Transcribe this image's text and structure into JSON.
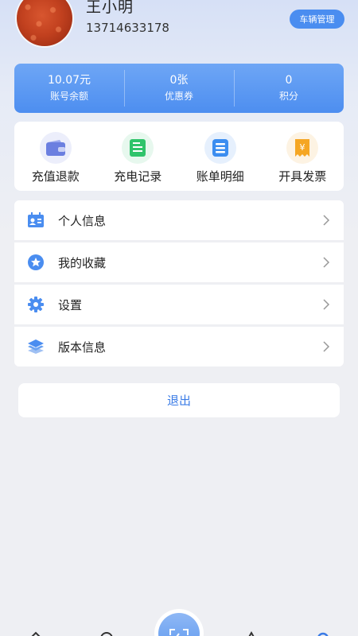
{
  "user": {
    "name": "王小明",
    "phone": "13714633178",
    "vehicle_button": "车辆管理"
  },
  "stats": [
    {
      "value": "10.07元",
      "label": "账号余额"
    },
    {
      "value": "0张",
      "label": "优惠券"
    },
    {
      "value": "0",
      "label": "积分"
    }
  ],
  "quick_actions": [
    {
      "label": "充值退款",
      "icon": "wallet-icon",
      "color": "#6b7fe0"
    },
    {
      "label": "充电记录",
      "icon": "record-icon",
      "color": "#2fc46b"
    },
    {
      "label": "账单明细",
      "icon": "bill-icon",
      "color": "#3b8df0"
    },
    {
      "label": "开具发票",
      "icon": "invoice-icon",
      "color": "#f5a623"
    }
  ],
  "menu": [
    {
      "label": "个人信息",
      "icon": "id-card-icon"
    },
    {
      "label": "我的收藏",
      "icon": "star-icon"
    },
    {
      "label": "设置",
      "icon": "gear-icon"
    },
    {
      "label": "版本信息",
      "icon": "layers-icon"
    }
  ],
  "logout_label": "退出",
  "colors": {
    "accent": "#4d8ef0",
    "background": "#eeeff3"
  }
}
